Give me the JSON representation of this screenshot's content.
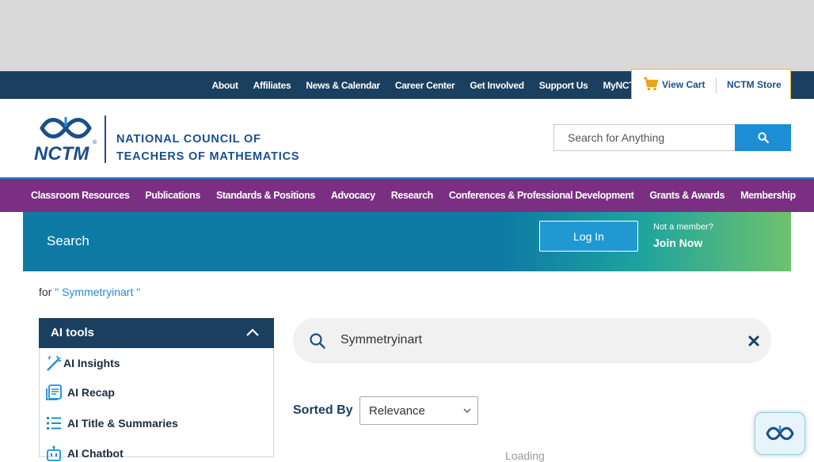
{
  "utility_nav": {
    "links": [
      "About",
      "Affiliates",
      "News & Calendar",
      "Career Center",
      "Get Involved",
      "Support Us",
      "MyNCTM"
    ],
    "cart_label": "View Cart",
    "store_label": "NCTM Store"
  },
  "header": {
    "logo_abbrev": "NCTM",
    "org_line1": "NATIONAL COUNCIL OF",
    "org_line2": "TEACHERS OF MATHEMATICS",
    "search_placeholder": "Search for Anything"
  },
  "main_nav": {
    "items": [
      "Classroom Resources",
      "Publications",
      "Standards & Positions",
      "Advocacy",
      "Research",
      "Conferences & Professional Development",
      "Grants & Awards",
      "Membership"
    ]
  },
  "banner": {
    "title": "Search",
    "login_label": "Log In",
    "not_member": "Not a member?",
    "join_label": "Join Now"
  },
  "results": {
    "for_prefix": "for",
    "query_display": "\" Symmetryinart \"",
    "search_value": "Symmetryinart",
    "sorted_by_label": "Sorted By",
    "sort_value": "Relevance",
    "loading_text": "Loading"
  },
  "ai_tools": {
    "title": "AI tools",
    "items": [
      {
        "label": "AI Insights",
        "icon": "magic-wand-icon"
      },
      {
        "label": "AI Recap",
        "icon": "document-stack-icon"
      },
      {
        "label": "AI Title & Summaries",
        "icon": "numbered-list-icon"
      },
      {
        "label": "AI Chatbot",
        "icon": "robot-icon"
      }
    ]
  },
  "colors": {
    "utility_bg": "#1b3f5e",
    "main_nav_bg": "#7b2f83",
    "accent_blue": "#1c8ed6",
    "banner_teal": "#0e7aa3",
    "banner_green": "#6fc26d"
  }
}
